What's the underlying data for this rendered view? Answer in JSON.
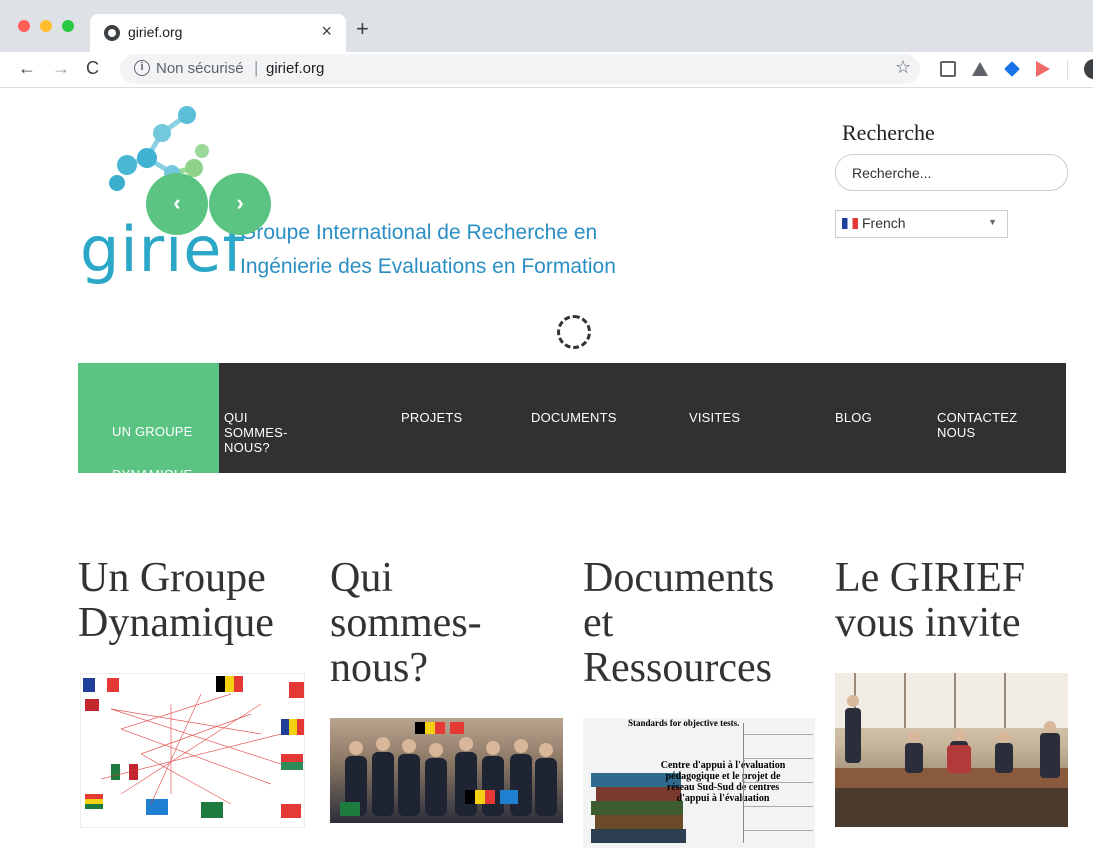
{
  "browser": {
    "tab_title": "girief.org",
    "tab_close": "×",
    "new_tab": "+",
    "security_label": "Non sécurisé",
    "url": "girief.org",
    "separator": "|"
  },
  "header": {
    "logo_text": "girief",
    "tagline_line1": "Groupe International de Recherche en",
    "tagline_line2": "Ingénierie des Evaluations en Formation",
    "slider_prev": "‹",
    "slider_next": "›"
  },
  "search": {
    "title": "Recherche",
    "placeholder": "Recherche...",
    "language": "French"
  },
  "nav": {
    "items": [
      {
        "label": "UN GROUPE DYNAMIQUE"
      },
      {
        "label": "QUI SOMMES-NOUS?"
      },
      {
        "label": "PROJETS"
      },
      {
        "label": "DOCUMENTS"
      },
      {
        "label": "VISITES"
      },
      {
        "label": "BLOG"
      },
      {
        "label": "CONTACTEZ NOUS"
      }
    ]
  },
  "columns": [
    {
      "title": "Un Groupe Dynamique"
    },
    {
      "title": "Qui sommes-nous?"
    },
    {
      "title": "Documents et Ressources"
    },
    {
      "title": "Le GIRIEF vous invite"
    }
  ],
  "thumbs": {
    "docs_heading": "Standards for objective tests.",
    "docs_caption": "Centre d'appui à l'évaluation pédagogique et le projet de réseau Sud-Sud de centres d'appui à l'évaluation"
  },
  "colors": {
    "accent_green": "#5cc483",
    "nav_bg": "#323031",
    "logo_blue": "#2ba7c8",
    "tagline_blue": "#2a8fc4"
  }
}
